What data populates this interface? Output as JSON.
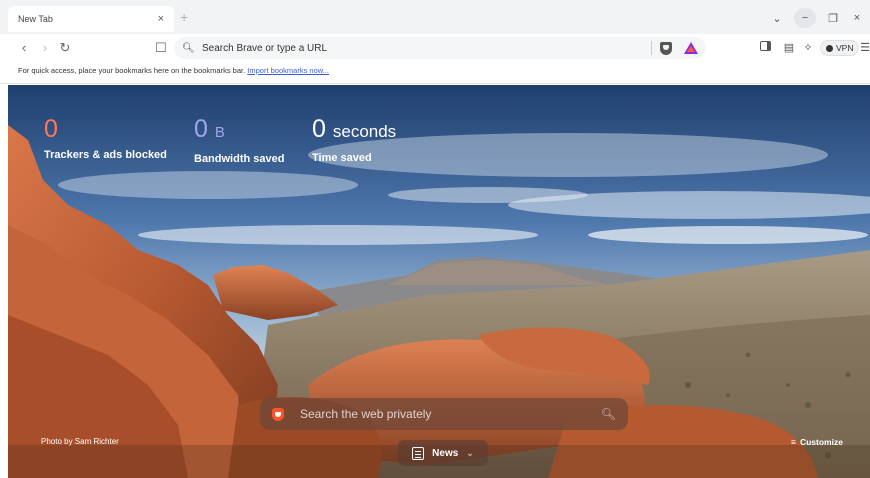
{
  "tab": {
    "title": "New Tab",
    "close_glyph": "×",
    "new_tab_glyph": "+"
  },
  "window_controls": {
    "tab_search": "⌄",
    "minimize": "−",
    "restore": "❐",
    "close": "×"
  },
  "toolbar": {
    "back": "‹",
    "forward": "›",
    "reload": "↻",
    "bookmark": "☐",
    "search_icon": "search-icon",
    "url_placeholder": "Search Brave or type a URL",
    "vpn_label": "VPN",
    "menu_glyph": "☰",
    "sidebar_glyph": "◧",
    "wallet_glyph": "▤",
    "extensions_glyph": "✧"
  },
  "bookmarks_bar": {
    "text": "For quick access, place your bookmarks here on the bookmarks bar.",
    "link": "Import bookmarks now..."
  },
  "stats": {
    "trackers": {
      "value": "0",
      "label": "Trackers & ads blocked",
      "color": "#ff7654"
    },
    "bandwidth": {
      "value": "0",
      "unit": "B",
      "label": "Bandwidth saved",
      "color": "#a0a5eb"
    },
    "time": {
      "value": "0",
      "unit": "seconds",
      "label": "Time saved",
      "color": "#ffffff"
    }
  },
  "search": {
    "placeholder": "Search the web privately",
    "icon": "search-icon"
  },
  "photo_credit": "Photo by Sam Richter",
  "customize_label": "Customize",
  "news_label": "News"
}
